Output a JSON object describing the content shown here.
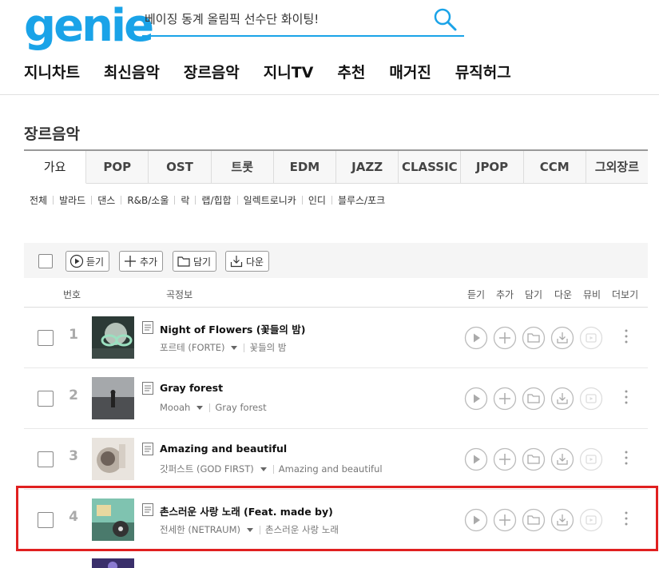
{
  "header": {
    "logo": "genie",
    "search_value": "베이징 동계 올림픽 선수단 화이팅!"
  },
  "gnb": [
    "지니차트",
    "최신음악",
    "장르음악",
    "지니TV",
    "추천",
    "매거진",
    "뮤직허그"
  ],
  "section_title": "장르음악",
  "genre_tabs": [
    "가요",
    "POP",
    "OST",
    "트롯",
    "EDM",
    "JAZZ",
    "CLASSIC",
    "JPOP",
    "CCM",
    "그외장르"
  ],
  "active_tab": "가요",
  "subcategories": [
    "전체",
    "발라드",
    "댄스",
    "R&B/소울",
    "락",
    "랩/힙합",
    "일렉트로니카",
    "인디",
    "블루스/포크"
  ],
  "toolbar": {
    "listen": "듣기",
    "add": "추가",
    "save": "담기",
    "download": "다운"
  },
  "columns": {
    "number": "번호",
    "info": "곡정보",
    "listen": "듣기",
    "add": "추가",
    "save": "담기",
    "download": "다운",
    "mv": "뮤비",
    "more": "더보기"
  },
  "songs": [
    {
      "num": "1",
      "title": "Night of Flowers (꽃들의 밤)",
      "artist": "포르테 (FORTE)",
      "album": "꽃들의 밤"
    },
    {
      "num": "2",
      "title": "Gray forest",
      "artist": "Mooah",
      "album": "Gray forest"
    },
    {
      "num": "3",
      "title": "Amazing and beautiful",
      "artist": "갓퍼스트 (GOD FIRST)",
      "album": "Amazing and beautiful"
    },
    {
      "num": "4",
      "title": "촌스러운 사랑 노래 (Feat. made by)",
      "artist": "전세한 (NETRAUM)",
      "album": "촌스러운 사랑 노래"
    }
  ],
  "colors": {
    "brand": "#1aa3e8",
    "highlight": "#e02020"
  }
}
